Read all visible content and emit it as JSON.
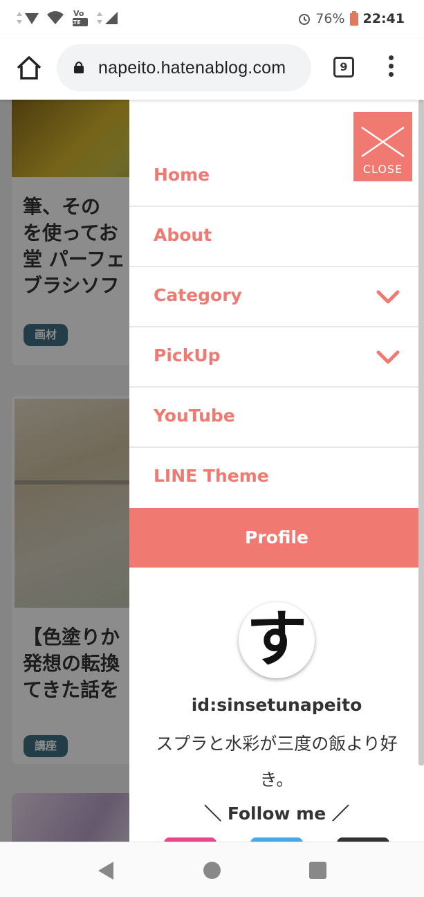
{
  "status_bar": {
    "battery": "76%",
    "time": "22:41",
    "network_badge": "LTE",
    "icons": [
      "signal-icon",
      "wifi-icon",
      "volte-icon",
      "cell-signal-icon",
      "alarm-icon",
      "battery-icon"
    ]
  },
  "browser": {
    "url": "napeito.hatenablog.com",
    "tab_count": "9",
    "icons": [
      "home-icon",
      "lock-icon",
      "menu-icon"
    ]
  },
  "background_cards": [
    {
      "title": "筆、その\nを使ってお\n堂 パーフェ\nブラシソフ",
      "tag": "画材"
    },
    {
      "title": "【色塗りか\n発想の転換\nてきた話を",
      "tag": "講座"
    },
    {
      "title": "",
      "tag": ""
    }
  ],
  "drawer": {
    "close_label": "CLOSE",
    "items": [
      {
        "label": "Home",
        "has_dropdown": false
      },
      {
        "label": "About",
        "has_dropdown": false
      },
      {
        "label": "Category",
        "has_dropdown": true
      },
      {
        "label": "PickUp",
        "has_dropdown": true
      },
      {
        "label": "YouTube",
        "has_dropdown": false
      },
      {
        "label": "LINE Theme",
        "has_dropdown": false
      }
    ],
    "profile_header": "Profile",
    "avatar_char": "す",
    "profile_id": "id:sinsetunapeito",
    "profile_desc": "スプラと水彩が三度の飯より好き。",
    "follow_text": "＼ Follow me ／",
    "accent_color": "#f07a72",
    "social_colors": [
      "#e8478b",
      "#45a9e8",
      "#333333"
    ]
  },
  "system_nav": {
    "icons": [
      "back-icon",
      "home-circle-icon",
      "recents-icon"
    ]
  }
}
